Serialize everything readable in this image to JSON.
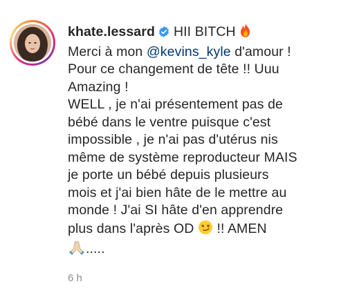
{
  "comment": {
    "username": "khate.lessard",
    "verified": true,
    "first_text": "HII BITCH",
    "line2_prefix": "Merci à mon ",
    "mention": "@kevins_kyle",
    "line2_suffix": " d'amour !",
    "lines": [
      "Pour ce changement de tête !! Uuu",
      "Amazing !",
      "WELL , je n'ai présentement pas de",
      "bébé dans le ventre puisque c'est",
      "impossible , je n'ai pas d'utérus nis",
      "même de système reproducteur MAIS",
      "je porte un bébé depuis plusieurs",
      "mois et j'ai bien hâte de le mettre au",
      "monde ! J'ai SI hâte d'en apprendre"
    ],
    "last_line_prefix": "plus dans l'après OD",
    "last_line_suffix": "!! AMEN",
    "final_dots": ".....",
    "emojis": [
      "fire-emoji",
      "smirking-face-emoji",
      "folded-hands-emoji"
    ],
    "timestamp": "6 h"
  },
  "colors": {
    "text": "#262626",
    "mention": "#00376b",
    "verified": "#3897f0",
    "timestamp": "#8e8e8e"
  }
}
